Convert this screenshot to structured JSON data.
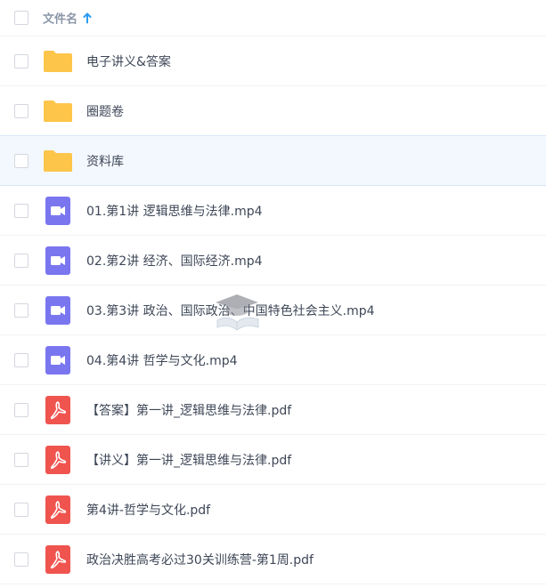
{
  "header": {
    "select_all": "",
    "label": "文件名",
    "sort_direction": "ascending"
  },
  "files": [
    {
      "name": "电子讲义&答案",
      "type": "folder"
    },
    {
      "name": "圈题卷",
      "type": "folder"
    },
    {
      "name": "资料库",
      "type": "folder",
      "selected": true
    },
    {
      "name": "01.第1讲 逻辑思维与法律.mp4",
      "type": "video"
    },
    {
      "name": "02.第2讲 经济、国际经济.mp4",
      "type": "video"
    },
    {
      "name": "03.第3讲 政治、国际政治、中国特色社会主义.mp4",
      "type": "video"
    },
    {
      "name": "04.第4讲 哲学与文化.mp4",
      "type": "video"
    },
    {
      "name": "【答案】第一讲_逻辑思维与法律.pdf",
      "type": "pdf"
    },
    {
      "name": "【讲义】第一讲_逻辑思维与法律.pdf",
      "type": "pdf"
    },
    {
      "name": "第4讲-哲学与文化.pdf",
      "type": "pdf"
    },
    {
      "name": "政治决胜高考必过30关训练营-第1周.pdf",
      "type": "pdf"
    }
  ],
  "watermark": {
    "text": "",
    "icon": "graduation-cap-book-icon"
  },
  "colors": {
    "folder": "#fdc54a",
    "video": "#7a76f0",
    "pdf": "#f0544f",
    "sort_arrow": "#2d9cf0",
    "selected_row": "#f3f8fe"
  }
}
